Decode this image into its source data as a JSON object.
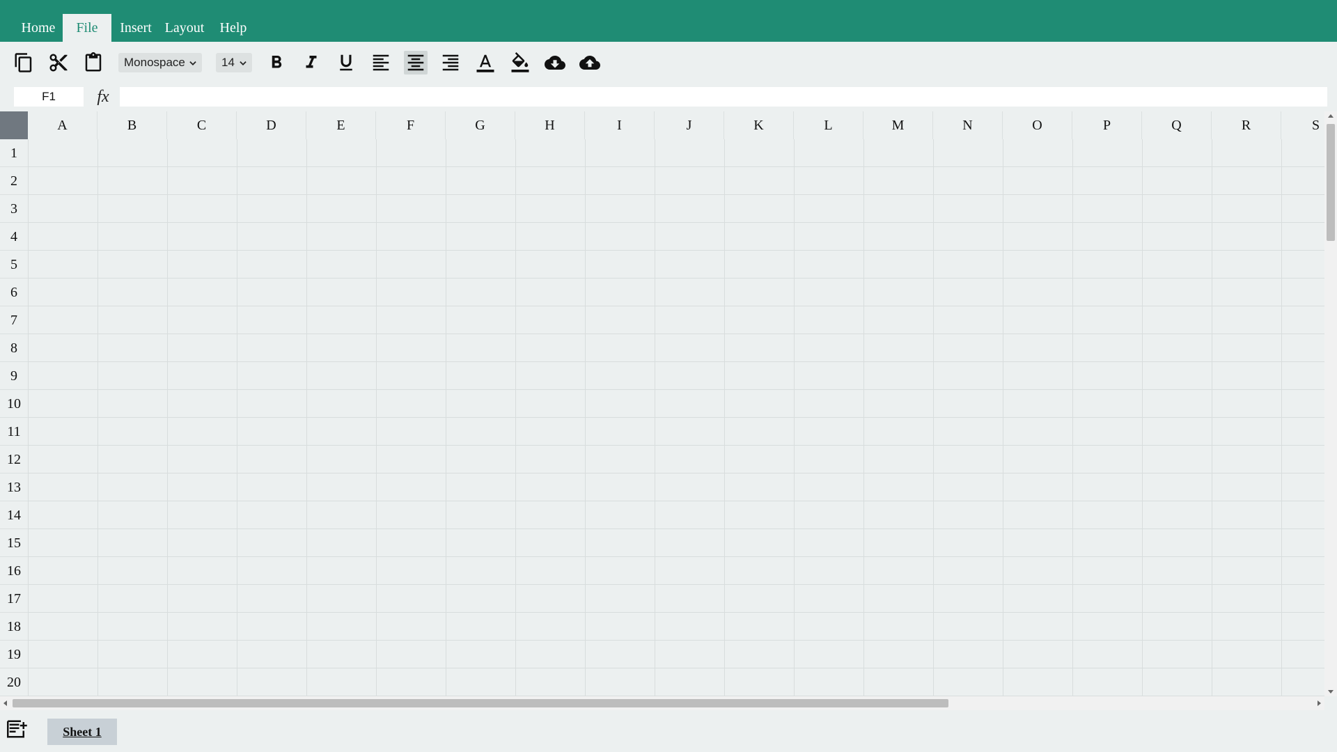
{
  "menu": {
    "items": [
      {
        "label": "Home",
        "active": false
      },
      {
        "label": "File",
        "active": true
      },
      {
        "label": "Insert",
        "active": false
      },
      {
        "label": "Layout",
        "active": false
      },
      {
        "label": "Help",
        "active": false
      }
    ]
  },
  "toolbar": {
    "font_family": "Monospace",
    "font_size": "14",
    "buttons": [
      "copy-icon",
      "cut-icon",
      "paste-icon",
      "bold-icon",
      "italic-icon",
      "underline-icon",
      "align-left-icon",
      "align-center-icon",
      "align-right-icon",
      "text-color-icon",
      "fill-color-icon",
      "download-icon",
      "upload-icon"
    ],
    "active_button": "align-center-icon"
  },
  "formula_bar": {
    "cell_reference": "F1",
    "fx_label": "fx",
    "formula_value": ""
  },
  "grid": {
    "columns": [
      "A",
      "B",
      "C",
      "D",
      "E",
      "F",
      "G",
      "H",
      "I",
      "J",
      "K",
      "L",
      "M",
      "N",
      "O",
      "P",
      "Q",
      "R",
      "S"
    ],
    "rows": [
      "1",
      "2",
      "3",
      "4",
      "5",
      "6",
      "7",
      "8",
      "9",
      "10",
      "11",
      "12",
      "13",
      "14",
      "15",
      "16",
      "17",
      "18",
      "19",
      "20"
    ]
  },
  "sheets": {
    "tabs": [
      {
        "label": "Sheet 1",
        "active": true
      }
    ]
  },
  "colors": {
    "accent": "#1f8c74",
    "background": "#ecf0f0",
    "corner": "#707880",
    "sheet_tab": "#c8d0d6"
  }
}
